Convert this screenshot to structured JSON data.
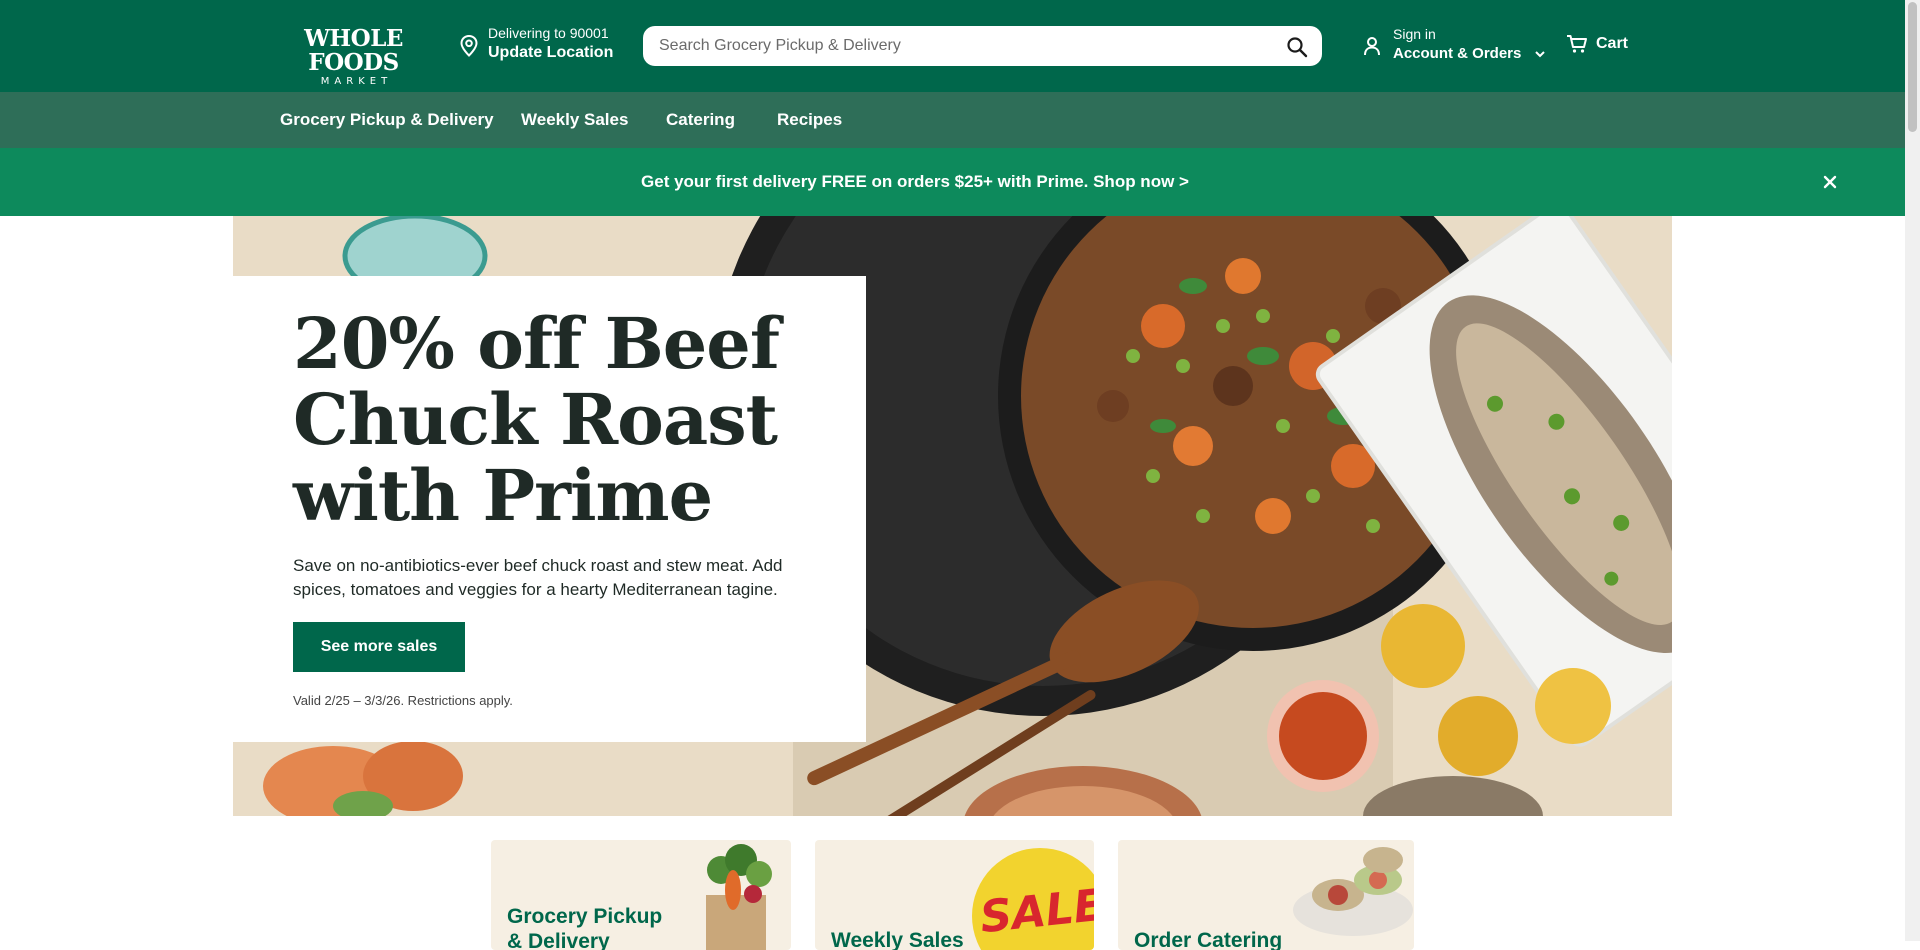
{
  "logo": {
    "line1": "WHOLE FOODS",
    "line2": "MARKET"
  },
  "location": {
    "delivering_to": "Delivering to 90001",
    "update_label": "Update Location"
  },
  "search": {
    "placeholder": "Search Grocery Pickup & Delivery"
  },
  "account": {
    "signin": "Sign in",
    "label": "Account & Orders"
  },
  "cart": {
    "label": "Cart"
  },
  "nav": {
    "items": [
      {
        "label": "Grocery Pickup & Delivery"
      },
      {
        "label": "Weekly Sales"
      },
      {
        "label": "Catering"
      },
      {
        "label": "Recipes"
      }
    ]
  },
  "promo": {
    "message": "Get your first delivery FREE on orders $25+ with Prime. Shop now >"
  },
  "hero": {
    "title": "20% off Beef Chuck Roast with Prime",
    "description": "Save on no-antibiotics-ever beef chuck roast and stew meat. Add spices, tomatoes and veggies for a hearty Mediterranean tagine.",
    "button": "See more sales",
    "valid": "Valid 2/25 – 3/3/26. Restrictions apply."
  },
  "tiles": [
    {
      "line1": "Grocery Pickup",
      "line2": "& Delivery"
    },
    {
      "line1": "Weekly Sales",
      "badge": "SALE"
    },
    {
      "line1": "Order Catering"
    }
  ],
  "colors": {
    "header": "#00674b",
    "nav": "#2e6e58",
    "promo": "#0d8a5c",
    "accent": "#00674b"
  },
  "icons": [
    "location-pin-icon",
    "search-icon",
    "user-icon",
    "chevron-down-icon",
    "cart-icon",
    "close-icon"
  ]
}
